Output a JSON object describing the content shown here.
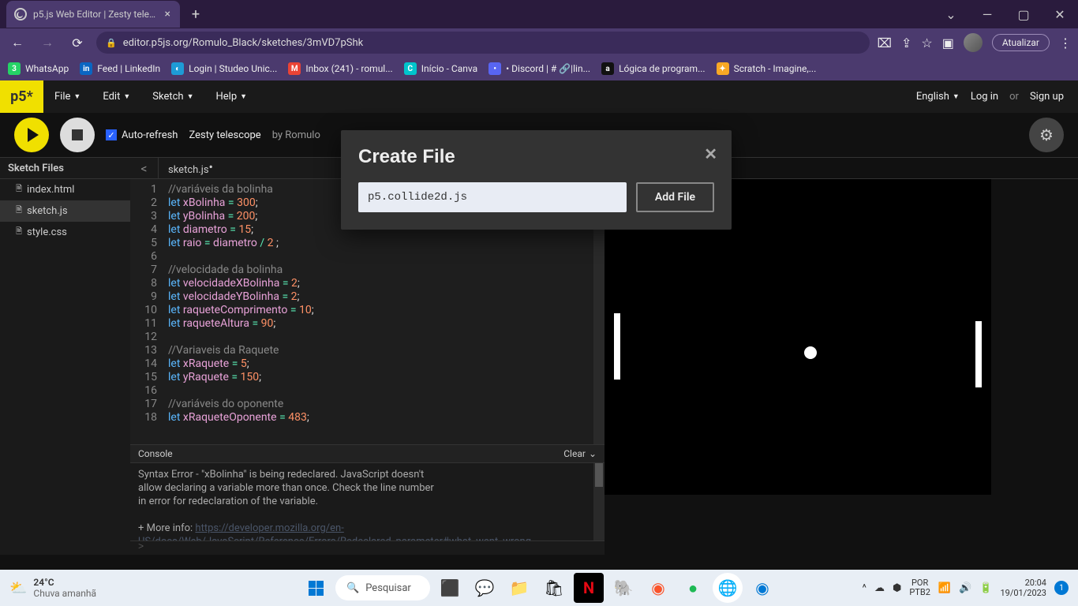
{
  "browser": {
    "tab_title": "p5.js Web Editor | Zesty telescope",
    "new_tab": "+",
    "url": "editor.p5js.org/Romulo_Black/sketches/3mVD7pShk",
    "update_btn": "Atualizar"
  },
  "bookmarks": [
    {
      "label": "WhatsApp",
      "bg": "#25D366",
      "ic": "3"
    },
    {
      "label": "Feed | LinkedIn",
      "bg": "#0A66C2",
      "ic": "in"
    },
    {
      "label": "Login | Studeo Unic...",
      "bg": "#1e9bd6",
      "ic": "◐"
    },
    {
      "label": "Inbox (241) - romul...",
      "bg": "#ea4335",
      "ic": "M"
    },
    {
      "label": "Início - Canva",
      "bg": "#00c4cc",
      "ic": "C"
    },
    {
      "label": "• Discord | # 🔗|lin...",
      "bg": "#5865F2",
      "ic": "•"
    },
    {
      "label": "Lógica de program...",
      "bg": "#111",
      "ic": "a"
    },
    {
      "label": "Scratch - Imagine,...",
      "bg": "#f9a825",
      "ic": "✦"
    }
  ],
  "menu": {
    "logo": "p5*",
    "file": "File",
    "edit": "Edit",
    "sketch": "Sketch",
    "help": "Help",
    "lang": "English",
    "login": "Log in",
    "or": "or",
    "signup": "Sign up"
  },
  "toolbar": {
    "auto": "Auto-refresh",
    "sketch_name": "Zesty telescope",
    "by": "by Romulo"
  },
  "sidebar": {
    "header": "Sketch Files",
    "files": [
      "index.html",
      "sketch.js",
      "style.css"
    ],
    "active": 1
  },
  "tab": {
    "file": "sketch.js"
  },
  "code": [
    {
      "n": 1,
      "html": "<span class='c-com'>//variáveis da bolinha</span>"
    },
    {
      "n": 2,
      "html": "<span class='c-key'>let</span> <span class='c-var'>xBolinha</span> <span class='c-op'>=</span> <span class='c-num'>300</span>;"
    },
    {
      "n": 3,
      "html": "<span class='c-key'>let</span> <span class='c-var'>yBolinha</span> <span class='c-op'>=</span> <span class='c-num'>200</span>;"
    },
    {
      "n": 4,
      "html": "<span class='c-key'>let</span> <span class='c-var'>diametro</span> <span class='c-op'>=</span> <span class='c-num'>15</span>;"
    },
    {
      "n": 5,
      "html": "<span class='c-key'>let</span> <span class='c-var'>raio</span> <span class='c-op'>=</span> <span class='c-var'>diametro</span> <span class='c-op'>/</span> <span class='c-num'>2</span> ;"
    },
    {
      "n": 6,
      "html": ""
    },
    {
      "n": 7,
      "html": "<span class='c-com'>//velocidade da bolinha</span>"
    },
    {
      "n": 8,
      "html": "<span class='c-key'>let</span> <span class='c-var'>velocidadeXBolinha</span> <span class='c-op'>=</span> <span class='c-num'>2</span>;"
    },
    {
      "n": 9,
      "html": "<span class='c-key'>let</span> <span class='c-var'>velocidadeYBolinha</span> <span class='c-op'>=</span> <span class='c-num'>2</span>;"
    },
    {
      "n": 10,
      "html": "<span class='c-key'>let</span> <span class='c-var'>raqueteComprimento</span> <span class='c-op'>=</span> <span class='c-num'>10</span>;"
    },
    {
      "n": 11,
      "html": "<span class='c-key'>let</span> <span class='c-var'>raqueteAltura</span> <span class='c-op'>=</span> <span class='c-num'>90</span>;"
    },
    {
      "n": 12,
      "html": ""
    },
    {
      "n": 13,
      "html": "<span class='c-com'>//Variaveis da Raquete</span>"
    },
    {
      "n": 14,
      "html": "<span class='c-key'>let</span> <span class='c-var'>xRaquete</span> <span class='c-op'>=</span> <span class='c-num'>5</span>;"
    },
    {
      "n": 15,
      "html": "<span class='c-key'>let</span> <span class='c-var'>yRaquete</span> <span class='c-op'>=</span> <span class='c-num'>150</span>;"
    },
    {
      "n": 16,
      "html": ""
    },
    {
      "n": 17,
      "html": "<span class='c-com'>//variáveis do oponente</span>"
    },
    {
      "n": 18,
      "html": "<span class='c-key'>let</span> <span class='c-var'>xRaqueteOponente</span> <span class='c-op'>=</span> <span class='c-num'>483</span>;"
    }
  ],
  "console": {
    "header": "Console",
    "clear": "Clear",
    "msg1": "Syntax Error - \"xBolinha\" is being redeclared. JavaScript doesn't",
    "msg2": "allow declaring a variable more than once. Check the line number",
    "msg3": "in error for redeclaration of the variable.",
    "more": "+ More info: ",
    "link": "https://developer.mozilla.org/en-US/docs/Web/JavaScript/Reference/Errors/Redeclared_parameter#what_went_wrong",
    "prompt": ">"
  },
  "modal": {
    "title": "Create File",
    "value": "p5.collide2d.js",
    "add": "Add File"
  },
  "taskbar": {
    "temp": "24°C",
    "cond": "Chuva amanhã",
    "search": "Pesquisar",
    "lang1": "POR",
    "lang2": "PTB2",
    "time": "20:04",
    "date": "19/01/2023",
    "notif": "1"
  }
}
